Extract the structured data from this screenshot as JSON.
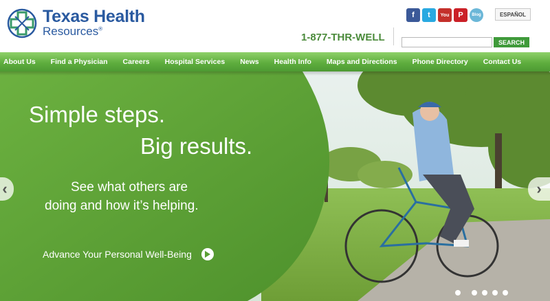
{
  "brand": {
    "line1": "Texas Health",
    "line2": "Resources",
    "mark_color": "#3a9a6a",
    "text_color": "#2a5aa0"
  },
  "social": [
    {
      "name": "facebook-icon",
      "glyph": "f",
      "color": "#3b5998"
    },
    {
      "name": "twitter-icon",
      "glyph": "t",
      "color": "#29a9e1"
    },
    {
      "name": "youtube-icon",
      "glyph": "You",
      "color": "#c4302b"
    },
    {
      "name": "pinterest-icon",
      "glyph": "P",
      "color": "#cb2027"
    },
    {
      "name": "blog-icon",
      "glyph": "Blog",
      "color": "#6bb7d8"
    }
  ],
  "header": {
    "language_label": "ESPAÑOL",
    "phone": "1-877-THR-WELL",
    "search_placeholder": "",
    "search_label": "SEARCH"
  },
  "nav": [
    "About Us",
    "Find a Physician",
    "Careers",
    "Hospital Services",
    "News",
    "Health Info",
    "Maps and Directions",
    "Phone Directory",
    "Contact Us"
  ],
  "hero": {
    "headline1": "Simple steps.",
    "headline2": "Big results.",
    "sub1": "See what others are",
    "sub2": "doing and how it’s helping.",
    "cta": "Advance Your Personal Well-Being",
    "slide_count": 5,
    "active_slide": 1
  },
  "colors": {
    "nav_green": "#5fae3e",
    "hero_green": "#5a9f34",
    "search_button": "#3f9a3a"
  }
}
